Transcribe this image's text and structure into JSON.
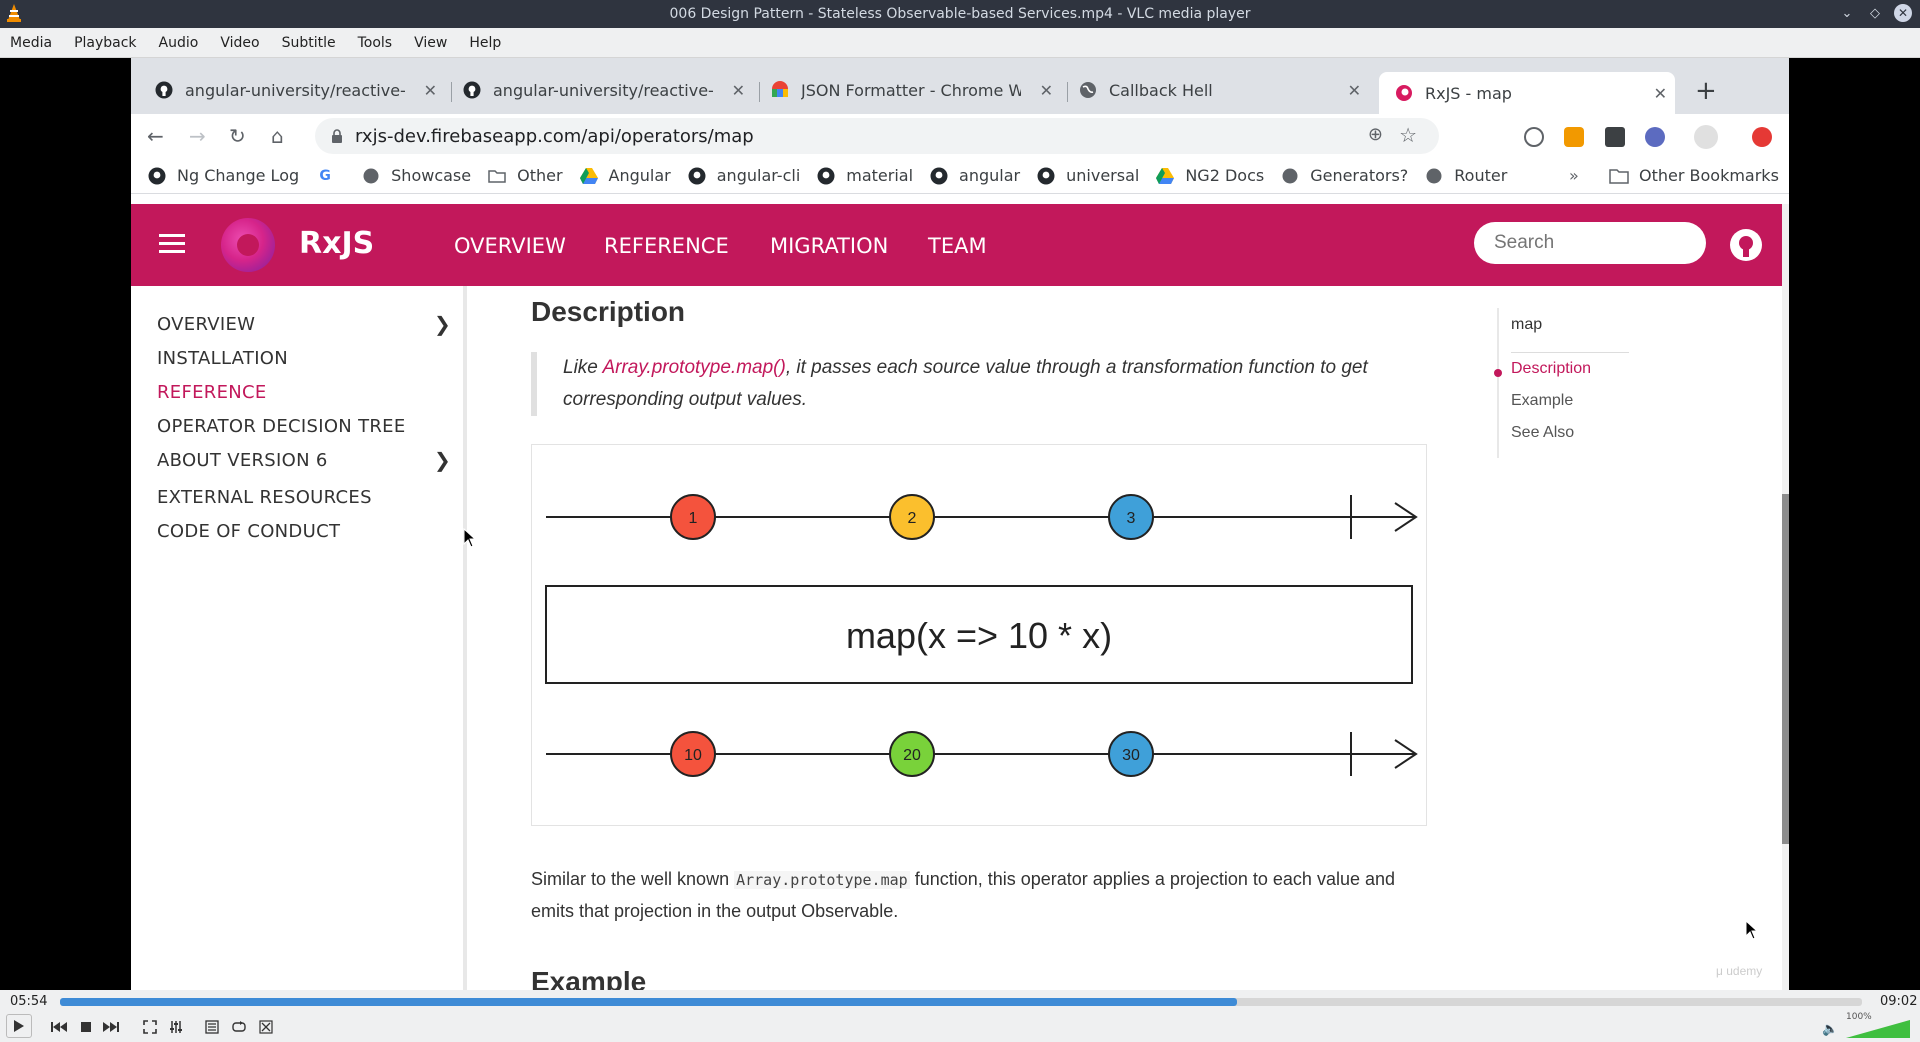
{
  "vlc": {
    "title": "006 Design Pattern - Stateless Observable-based Services.mp4 - VLC media player",
    "menu": [
      "Media",
      "Playback",
      "Audio",
      "Video",
      "Subtitle",
      "Tools",
      "View",
      "Help"
    ],
    "time_elapsed": "05:54",
    "time_total": "09:02",
    "progress": 0.653,
    "volume_label": "100%",
    "volume": 1.0
  },
  "browser": {
    "tabs": [
      {
        "title": "angular-university/reactive-an",
        "icon": "github-icon"
      },
      {
        "title": "angular-university/reactive-an",
        "icon": "github-icon"
      },
      {
        "title": "JSON Formatter - Chrome Wel",
        "icon": "chrome-webstore-icon"
      },
      {
        "title": "Callback Hell",
        "icon": "globe-icon"
      },
      {
        "title": "RxJS - map",
        "icon": "rxjs-icon"
      }
    ],
    "url": "rxjs-dev.firebaseapp.com/api/operators/map",
    "bookmarks": [
      {
        "label": "Ng Change Log",
        "icon": "github-icon"
      },
      {
        "label": "",
        "icon": "google-icon"
      },
      {
        "label": "Showcase",
        "icon": "globe-icon"
      },
      {
        "label": "Other",
        "icon": "folder-icon"
      },
      {
        "label": "Angular",
        "icon": "drive-icon"
      },
      {
        "label": "angular-cli",
        "icon": "github-icon"
      },
      {
        "label": "material",
        "icon": "github-icon"
      },
      {
        "label": "angular",
        "icon": "github-icon"
      },
      {
        "label": "universal",
        "icon": "github-icon"
      },
      {
        "label": "NG2 Docs",
        "icon": "drive-icon"
      },
      {
        "label": "Generators?",
        "icon": "globe-icon"
      },
      {
        "label": "Router",
        "icon": "globe-icon"
      }
    ],
    "bookmarks_more": "»",
    "other_bookmarks": "Other Bookmarks"
  },
  "rxjs": {
    "brand": "RxJS",
    "nav": [
      "OVERVIEW",
      "REFERENCE",
      "MIGRATION",
      "TEAM"
    ],
    "search_placeholder": "Search",
    "sidebar": [
      {
        "label": "OVERVIEW",
        "chevron": true,
        "active": false
      },
      {
        "label": "INSTALLATION",
        "chevron": false,
        "active": false
      },
      {
        "label": "REFERENCE",
        "chevron": false,
        "active": true
      },
      {
        "label": "OPERATOR DECISION TREE",
        "chevron": false,
        "active": false
      },
      {
        "label": "ABOUT VERSION 6",
        "chevron": true,
        "active": false
      },
      {
        "label": "EXTERNAL RESOURCES",
        "chevron": false,
        "active": false
      },
      {
        "label": "CODE OF CONDUCT",
        "chevron": false,
        "active": false
      }
    ],
    "description_heading": "Description",
    "quote_prefix": "Like ",
    "quote_link": "Array.prototype.map()",
    "quote_rest": ", it passes each source value through a transformation function to get corresponding output values.",
    "marble": {
      "input_values": [
        "1",
        "2",
        "3"
      ],
      "input_colors": [
        "#f4533d",
        "#fbbf2d",
        "#3fa0d9"
      ],
      "operator_label": "map(x => 10 * x)",
      "output_values": [
        "10",
        "20",
        "30"
      ],
      "output_colors": [
        "#f4533d",
        "#79d23a",
        "#3fa0d9"
      ]
    },
    "para_prefix": "Similar to the well known ",
    "para_code": "Array.prototype.map",
    "para_rest": " function, this operator applies a projection to each value and emits that projection in the output Observable.",
    "example_heading": "Example",
    "toc": {
      "title": "map",
      "items": [
        "Description",
        "Example",
        "See Also"
      ],
      "active_index": 0
    },
    "accent_color": "#c2185b"
  }
}
